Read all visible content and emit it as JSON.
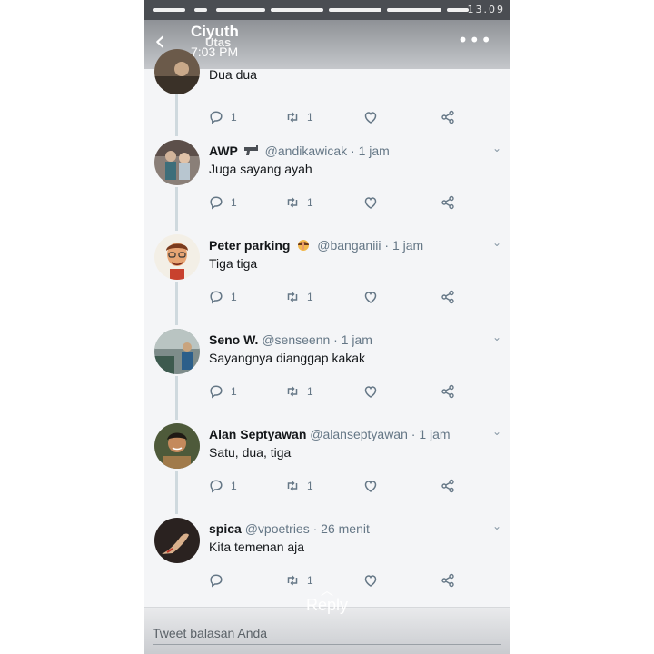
{
  "header": {
    "title": "Ciyuth",
    "subtitle": "Utas",
    "time": "7:03 PM",
    "back_icon": "back-arrow-icon",
    "more_icon": "more-dots-icon"
  },
  "status_bar": {
    "clock": "13.09"
  },
  "tweets": [
    {
      "name": "",
      "handle": "",
      "text": "Dua dua",
      "replies": "1",
      "retweets": "1"
    },
    {
      "name": "AWP",
      "emoji": "gun-emoji",
      "handle": "@andikawicak · 1 jam",
      "text": "Juga sayang ayah",
      "replies": "1",
      "retweets": "1"
    },
    {
      "name": "Peter parking",
      "emoji": "woman-facepalm-emoji",
      "handle": "@banganiii · 1 jam",
      "text": "Tiga tiga",
      "replies": "1",
      "retweets": "1"
    },
    {
      "name": "Seno W.",
      "handle": "@senseenn · 1 jam",
      "text": "Sayangnya dianggap kakak",
      "replies": "1",
      "retweets": "1"
    },
    {
      "name": "Alan Septyawan",
      "handle": "@alanseptyawan · 1 jam",
      "text": "Satu, dua, tiga",
      "replies": "1",
      "retweets": "1"
    },
    {
      "name": "spica",
      "handle": "@vpoetries · 26 menit",
      "text": "Kita temenan aja",
      "replies": "",
      "retweets": "1"
    }
  ],
  "reply_hint": "Reply",
  "compose": {
    "placeholder": "Tweet balasan Anda"
  },
  "colors": {
    "header_gradient_top": "#8e9196",
    "thread_line": "#cfd9de",
    "muted_text": "#657786"
  }
}
